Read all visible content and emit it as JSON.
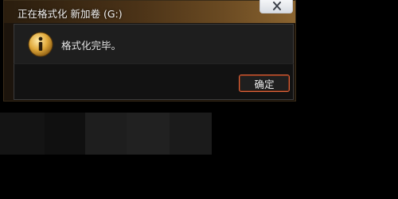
{
  "dialog": {
    "title": "正在格式化 新加卷 (G:)",
    "message": "格式化完毕。",
    "ok_label": "确定",
    "close_icon": "close-icon",
    "info_icon": "info-icon"
  },
  "colors": {
    "titlebar_accent": "#8a6430",
    "ok_border": "#e0643c",
    "background": "#000000"
  }
}
